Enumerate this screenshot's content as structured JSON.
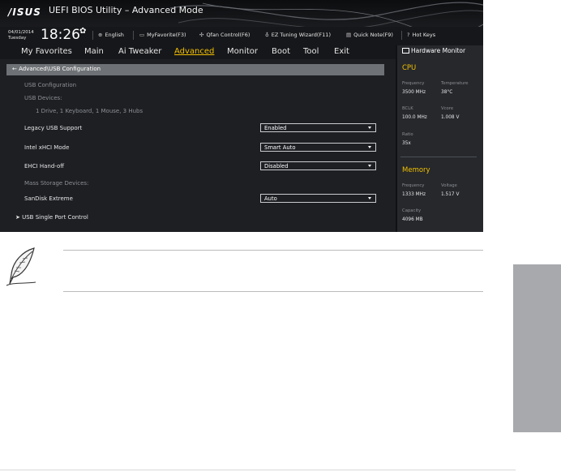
{
  "header": {
    "logo": "/ISUS",
    "title": "UEFI BIOS Utility – Advanced Mode",
    "date": "04/01/2014",
    "day": "Tuesday",
    "time": "18:26",
    "toolbar": [
      {
        "name": "language",
        "label": "English",
        "icon": "globe-icon"
      },
      {
        "name": "myfavorite",
        "label": "MyFavorite(F3)",
        "icon": "folder-icon"
      },
      {
        "name": "qfan",
        "label": "Qfan Control(F6)",
        "icon": "fan-icon"
      },
      {
        "name": "ez-tuning",
        "label": "EZ Tuning Wizard(F11)",
        "icon": "bulb-icon"
      },
      {
        "name": "quick-note",
        "label": "Quick Note(F9)",
        "icon": "note-icon"
      },
      {
        "name": "hot-keys",
        "label": "Hot Keys",
        "icon": "keyboard-icon"
      }
    ]
  },
  "menu": {
    "items": [
      "My Favorites",
      "Main",
      "Ai Tweaker",
      "Advanced",
      "Monitor",
      "Boot",
      "Tool",
      "Exit"
    ],
    "active": "Advanced"
  },
  "breadcrumb": "Advanced\\USB Configuration",
  "content": {
    "section_title": "USB Configuration",
    "usb_devices_label": "USB Devices:",
    "usb_devices_value": "1 Drive, 1 Keyboard, 1 Mouse, 3 Hubs",
    "settings": [
      {
        "label": "Legacy USB Support",
        "value": "Enabled"
      },
      {
        "label": "Intel xHCI Mode",
        "value": "Smart Auto"
      },
      {
        "label": "EHCI Hand-off",
        "value": "Disabled"
      }
    ],
    "mass_storage_label": "Mass Storage Devices:",
    "mass_storage_device": {
      "label": "SanDisk Extreme",
      "value": "Auto"
    },
    "submenu": "USB Single Port Control"
  },
  "hardware_monitor": {
    "title": "Hardware Monitor",
    "cpu": {
      "title": "CPU",
      "frequency_label": "Frequency",
      "frequency": "3500 MHz",
      "temperature_label": "Temperature",
      "temperature": "38°C",
      "bclk_label": "BCLK",
      "bclk": "100.0 MHz",
      "vcore_label": "Vcore",
      "vcore": "1.008 V",
      "ratio_label": "Ratio",
      "ratio": "35x"
    },
    "memory": {
      "title": "Memory",
      "frequency_label": "Frequency",
      "frequency": "1333 MHz",
      "voltage_label": "Voltage",
      "voltage": "1.517 V",
      "capacity_label": "Capacity",
      "capacity": "4096 MB"
    }
  },
  "colors": {
    "accent": "#f2c000",
    "bios_bg": "#1d1f23",
    "side_tab": "#a7a9ac"
  }
}
